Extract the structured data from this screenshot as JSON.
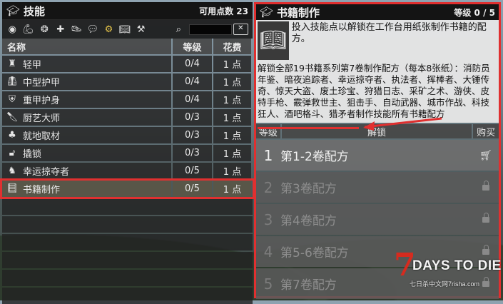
{
  "skills_panel": {
    "title": "技能",
    "points_label": "可用点数 23",
    "filter_icons": [
      "eye-icon",
      "strength-arm-icon",
      "brain-icon",
      "plus-icon",
      "running-shoe-icon",
      "chat-bubble-icon",
      "gear-icon",
      "book-icon",
      "hammer-icon"
    ],
    "search": {
      "value": "",
      "placeholder": ""
    },
    "columns": {
      "name": "名称",
      "level": "等级",
      "cost": "花费"
    },
    "rows": [
      {
        "icon": "light-armor-icon",
        "name": "轻甲",
        "level": "0/4",
        "cost": "1 点"
      },
      {
        "icon": "medium-armor-icon",
        "name": "中型护甲",
        "level": "0/4",
        "cost": "1 点"
      },
      {
        "icon": "heavy-armor-icon",
        "name": "重甲护身",
        "level": "0/4",
        "cost": "1 点"
      },
      {
        "icon": "chef-knife-icon",
        "name": "厨艺大师",
        "level": "0/3",
        "cost": "1 点"
      },
      {
        "icon": "tree-icon",
        "name": "就地取材",
        "level": "0/3",
        "cost": "1 点"
      },
      {
        "icon": "lock-icon",
        "name": "撬锁",
        "level": "0/3",
        "cost": "1 点"
      },
      {
        "icon": "lucky-looter-icon",
        "name": "幸运掠夺者",
        "level": "0/5",
        "cost": "1 点"
      },
      {
        "icon": "book-icon",
        "name": "书籍制作",
        "level": "0/5",
        "cost": "1 点"
      }
    ]
  },
  "detail_panel": {
    "title": "书籍制作",
    "level_label": "等级 0 / 5",
    "description": "投入技能点以解锁在工作台用纸张制作书籍的配方。",
    "body": "解锁全部19书籍系列第7卷制作配方（每本8张纸）：消防员年鉴、暗夜追踪者、幸运掠夺者、执法者、挥棒者、大锤传奇、惊天大盗、废土珍宝、狩猎日志、采矿之术、游侠、皮特手枪、霰弹救世主、狙击手、自动武器、城市作战、科技狂人、酒吧格斗、猎矛者制作技能所有书籍配方",
    "columns": {
      "level": "等级",
      "unlock": "解锁",
      "buy": "购买"
    },
    "recipes": [
      {
        "num": "1",
        "name": "第1-2卷配方",
        "icon": "cart-icon",
        "state": "unlocked"
      },
      {
        "num": "2",
        "name": "第3卷配方",
        "icon": "lock-icon",
        "state": "locked"
      },
      {
        "num": "3",
        "name": "第4卷配方",
        "icon": "lock-icon",
        "state": "locked"
      },
      {
        "num": "4",
        "name": "第5-6卷配方",
        "icon": "lock-icon",
        "state": "locked"
      },
      {
        "num": "5",
        "name": "第7卷配方",
        "icon": "lock-icon",
        "state": "locked"
      }
    ]
  },
  "watermark": {
    "seven": "7",
    "title": "DAYS TO DIE",
    "subtitle": "七日杀中文网7risha.com"
  },
  "colors": {
    "highlight": "#e03030",
    "gear": "#e8c64a",
    "panel_dark": "#141414"
  }
}
